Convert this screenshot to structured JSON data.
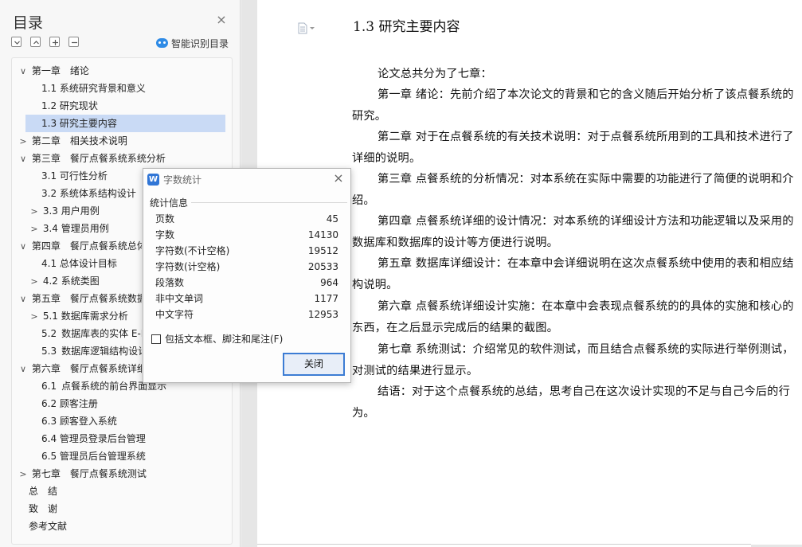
{
  "nav": {
    "title": "目录",
    "close": "×",
    "smart_label": "智能识别目录",
    "items": [
      {
        "arrow": "∨",
        "label": "第一章　绪论"
      },
      {
        "arrow": "",
        "label": "1.1 系统研究背景和意义"
      },
      {
        "arrow": "",
        "label": "1.2 研究现状"
      },
      {
        "arrow": "",
        "label": "1.3 研究主要内容"
      },
      {
        "arrow": ">",
        "label": "第二章　相关技术说明"
      },
      {
        "arrow": "∨",
        "label": "第三章　餐厅点餐系统系统分析"
      },
      {
        "arrow": "",
        "label": "3.1 可行性分析"
      },
      {
        "arrow": "",
        "label": "3.2 系统体系结构设计"
      },
      {
        "arrow": ">",
        "label": "3.3 用户用例"
      },
      {
        "arrow": ">",
        "label": "3.4 管理员用例"
      },
      {
        "arrow": "∨",
        "label": "第四章　餐厅点餐系统总体"
      },
      {
        "arrow": "",
        "label": "4.1 总体设计目标"
      },
      {
        "arrow": ">",
        "label": "4.2 系统类图"
      },
      {
        "arrow": "∨",
        "label": "第五章　餐厅点餐系统数据"
      },
      {
        "arrow": ">",
        "label": "5.1 数据库需求分析"
      },
      {
        "arrow": "",
        "label": "5.2 数据库表的实体 E-R"
      },
      {
        "arrow": "",
        "label": "5.3 数据库逻辑结构设计"
      },
      {
        "arrow": "∨",
        "label": "第六章　餐厅点餐系统详细"
      },
      {
        "arrow": "",
        "label": "6.1 点餐系统的前台界面显示"
      },
      {
        "arrow": "",
        "label": "6.2 顾客注册"
      },
      {
        "arrow": "",
        "label": "6.3 顾客登入系统"
      },
      {
        "arrow": "",
        "label": "6.4 管理员登录后台管理"
      },
      {
        "arrow": "",
        "label": "6.5 管理员后台管理系统"
      },
      {
        "arrow": ">",
        "label": "第七章　餐厅点餐系统测试"
      },
      {
        "arrow": "",
        "label": "总　结"
      },
      {
        "arrow": "",
        "label": "致　谢"
      },
      {
        "arrow": "",
        "label": "参考文献"
      }
    ]
  },
  "document": {
    "heading": "1.3 研究主要内容",
    "paragraphs": [
      "论文总共分为了七章：",
      "第一章 绪论：先前介绍了本次论文的背景和它的含义随后开始分析了该点餐系统的研究。",
      "第二章 对于在点餐系统的有关技术说明：对于点餐系统所用到的工具和技术进行了详细的说明。",
      "第三章 点餐系统的分析情况：对本系统在实际中需要的功能进行了简便的说明和介绍。",
      "第四章 点餐系统详细的设计情况：对本系统的详细设计方法和功能逻辑以及采用的数据库和数据库的设计等方便进行说明。",
      "第五章 数据库详细设计：在本章中会详细说明在这次点餐系统中使用的表和相应结构说明。",
      "第六章 点餐系统详细设计实施：在本章中会表现点餐系统的的具体的实施和核心的东西，在之后显示完成后的结果的截图。",
      "第七章 系统测试：介绍常见的软件测试，而且结合点餐系统的实际进行举例测试，对测试的结果进行显示。",
      "结语：对于这个点餐系统的总结，思考自己在这次设计实现的不足与自己今后的行为。"
    ]
  },
  "dialog": {
    "icon_letter": "W",
    "title": "字数统计",
    "close": "×",
    "section": "统计信息",
    "stats": [
      {
        "label": "页数",
        "value": "45"
      },
      {
        "label": "字数",
        "value": "14130"
      },
      {
        "label": "字符数(不计空格)",
        "value": "19512"
      },
      {
        "label": "字符数(计空格)",
        "value": "20533"
      },
      {
        "label": "段落数",
        "value": "964"
      },
      {
        "label": "非中文单词",
        "value": "1177"
      },
      {
        "label": "中文字符",
        "value": "12953"
      }
    ],
    "checkbox_label": "包括文本框、脚注和尾注(F)",
    "checkbox_checked": false,
    "ok_label": "关闭"
  }
}
